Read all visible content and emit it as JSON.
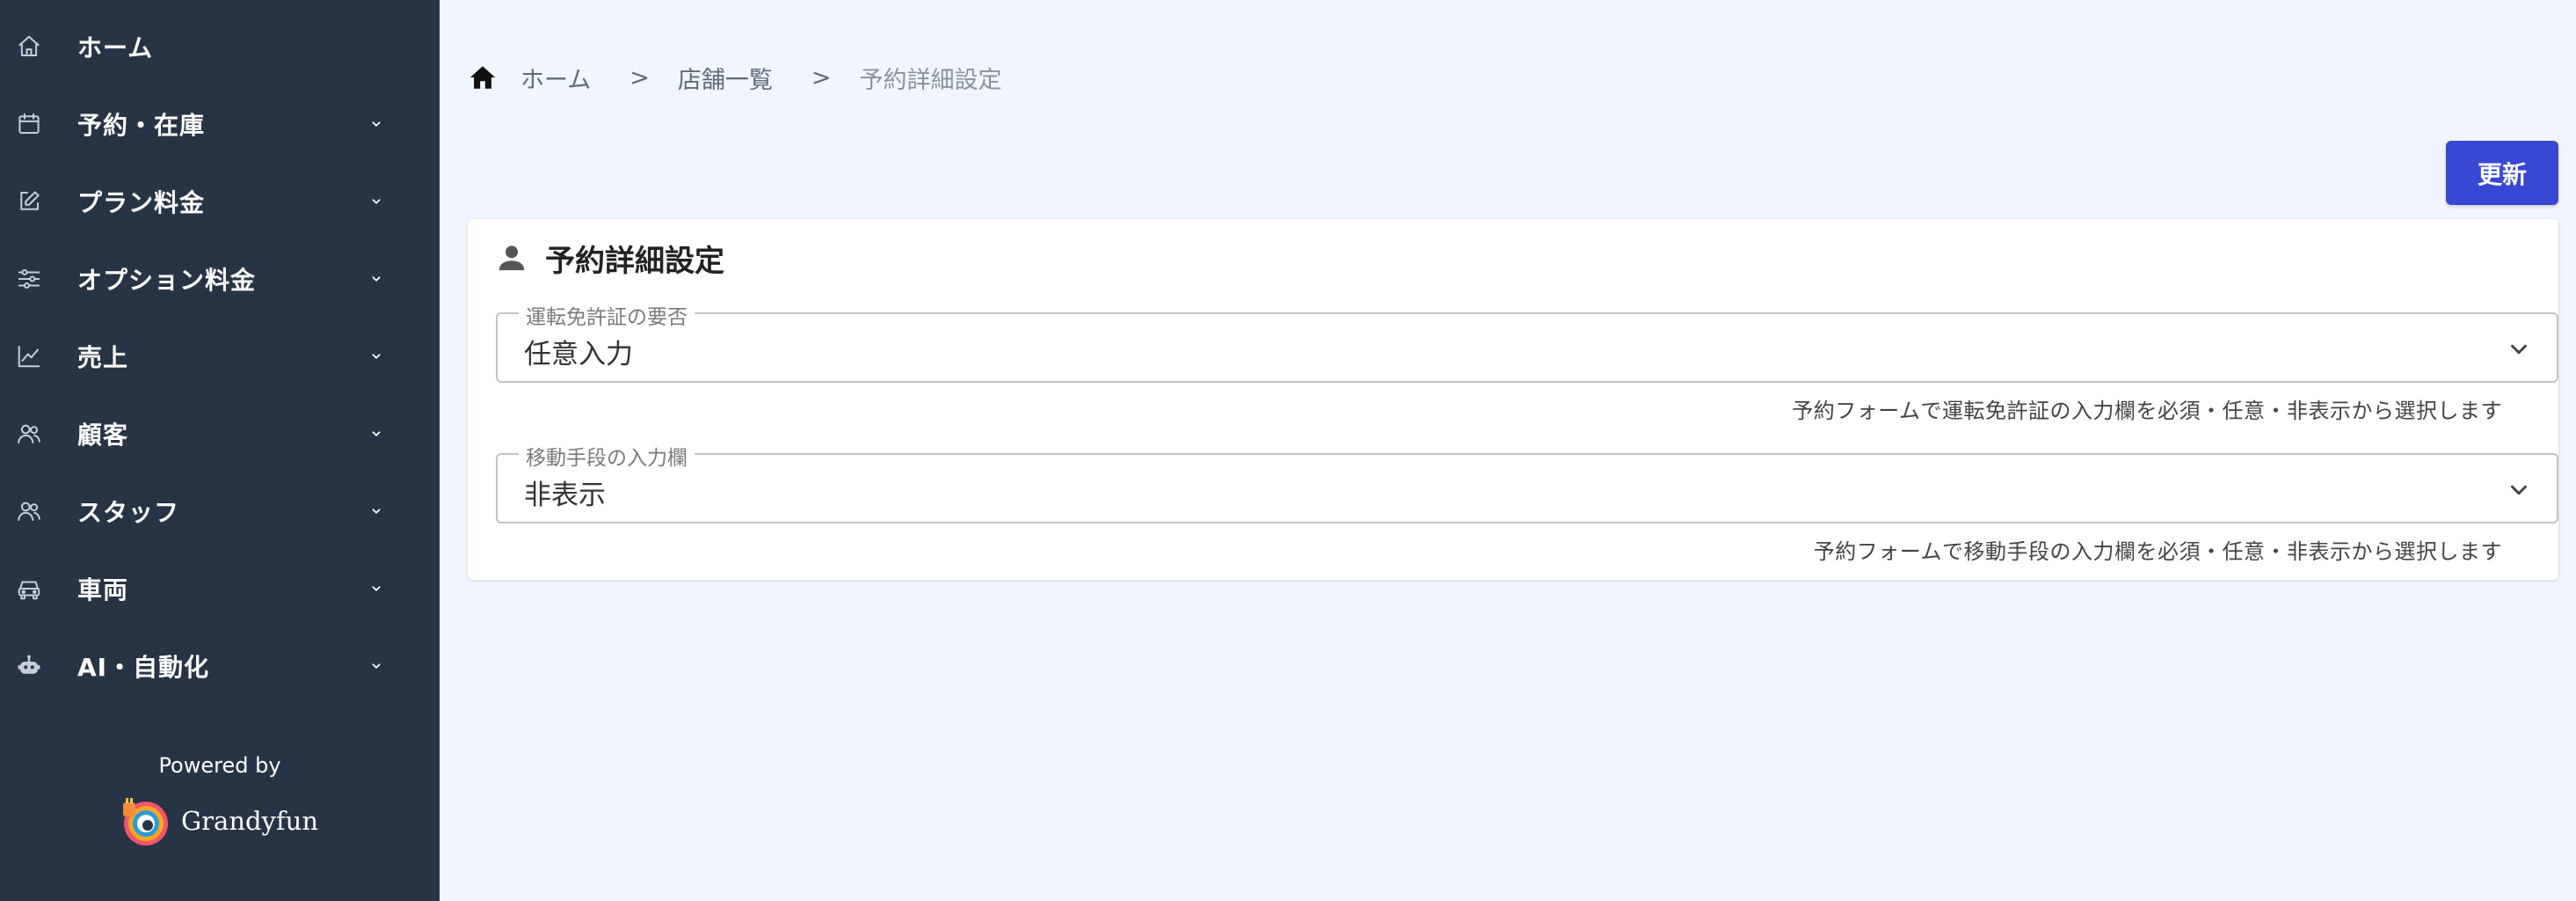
{
  "sidebar": {
    "items": [
      {
        "label": "ホーム",
        "icon": "home-outline-icon",
        "expandable": false
      },
      {
        "label": "予約・在庫",
        "icon": "calendar-icon",
        "expandable": true
      },
      {
        "label": "プラン料金",
        "icon": "edit-icon",
        "expandable": true
      },
      {
        "label": "オプション料金",
        "icon": "sliders-icon",
        "expandable": true
      },
      {
        "label": "売上",
        "icon": "chart-line-icon",
        "expandable": true
      },
      {
        "label": "顧客",
        "icon": "users-icon",
        "expandable": true
      },
      {
        "label": "スタッフ",
        "icon": "users-icon",
        "expandable": true
      },
      {
        "label": "車両",
        "icon": "car-icon",
        "expandable": true
      },
      {
        "label": "AI・自動化",
        "icon": "robot-icon",
        "expandable": true
      }
    ],
    "powered_by": "Powered by",
    "brand_name": "Grandyfun"
  },
  "breadcrumb": {
    "items": [
      "ホーム",
      "店舗一覧",
      "予約詳細設定"
    ],
    "separator": ">"
  },
  "toolbar": {
    "update_label": "更新"
  },
  "card": {
    "title": "予約詳細設定",
    "fields": [
      {
        "label": "運転免許証の要否",
        "value": "任意入力",
        "helper": "予約フォームで運転免許証の入力欄を必須・任意・非表示から選択します"
      },
      {
        "label": "移動手段の入力欄",
        "value": "非表示",
        "helper": "予約フォームで移動手段の入力欄を必須・任意・非表示から選択します"
      }
    ]
  },
  "colors": {
    "sidebar_bg": "#263445",
    "page_bg": "#f1f5fd",
    "primary": "#3848d3"
  }
}
